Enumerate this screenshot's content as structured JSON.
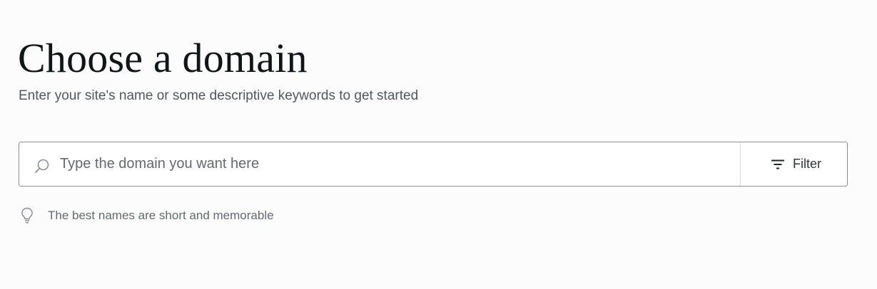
{
  "header": {
    "title": "Choose a domain",
    "subtitle": "Enter your site's name or some descriptive keywords to get started"
  },
  "search": {
    "placeholder": "Type the domain you want here",
    "value": "",
    "icon": "search-icon"
  },
  "filter": {
    "label": "Filter",
    "icon": "filter-icon"
  },
  "tip": {
    "icon": "lightbulb-icon",
    "text": "The best names are short and memorable"
  },
  "colors": {
    "background": "#fcfcfc",
    "border": "#8c8f94",
    "divider": "#dcdcde",
    "text_primary": "#101517",
    "text_secondary": "#646970"
  }
}
